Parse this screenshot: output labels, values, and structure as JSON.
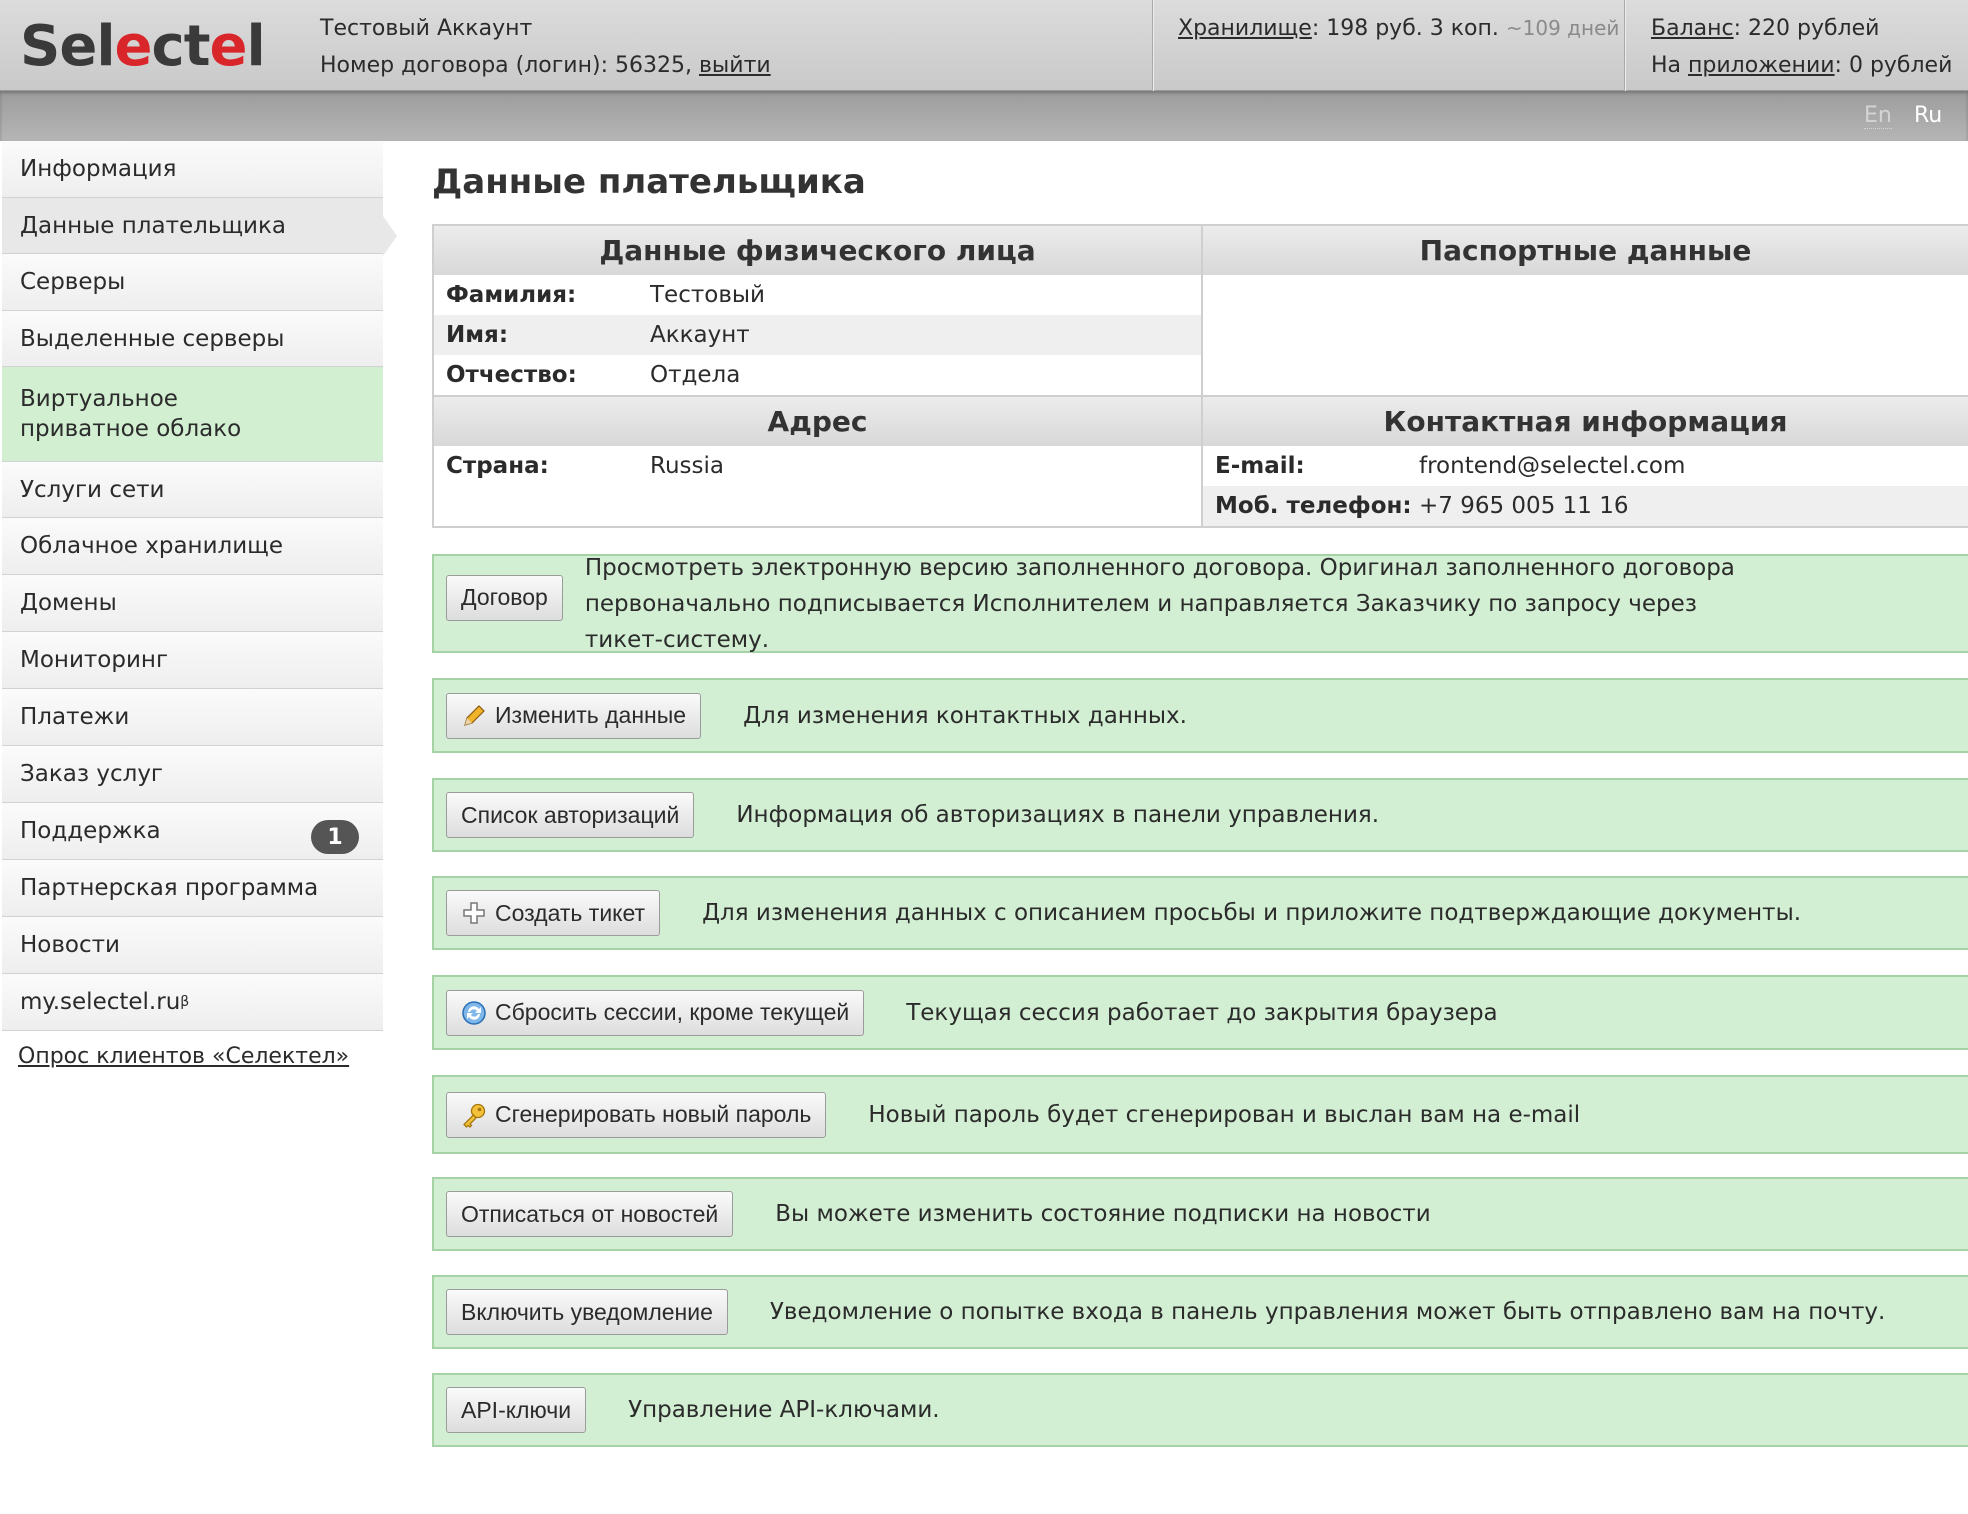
{
  "header": {
    "logo": {
      "part1": "Sel",
      "red": "e",
      "part2": "ct",
      "red2": "e",
      "part3": "l"
    },
    "account_name": "Тестовый Аккаунт",
    "contract_label": "Номер договора (логин): 56325,",
    "logout": "выйти",
    "storage_link": "Хранилище",
    "storage_value": ": 198 руб. 3 коп.",
    "storage_days": "~109 дней",
    "balance_link": "Баланс",
    "balance_value": ": 220 рублей",
    "app_prefix": "На",
    "app_link": "приложении",
    "app_value": ": 0 рублей"
  },
  "lang": {
    "en": "En",
    "ru": "Ru"
  },
  "sidebar": {
    "items": [
      {
        "label": "Информация"
      },
      {
        "label": "Данные плательщика"
      },
      {
        "label": "Серверы"
      },
      {
        "label": "Выделенные серверы"
      },
      {
        "label": "Виртуальное приватное облако"
      },
      {
        "label": "Услуги сети"
      },
      {
        "label": "Облачное хранилище"
      },
      {
        "label": "Домены"
      },
      {
        "label": "Мониторинг"
      },
      {
        "label": "Платежи"
      },
      {
        "label": "Заказ услуг"
      },
      {
        "label": "Поддержка",
        "badge": "1"
      },
      {
        "label": "Партнерская программа"
      },
      {
        "label": "Новости"
      },
      {
        "label": "my.selectel.ru",
        "sup": "β"
      }
    ],
    "survey": "Опрос клиентов «Селектел»"
  },
  "page": {
    "title": "Данные плательщика",
    "personal": {
      "heading": "Данные физического лица",
      "rows": [
        {
          "label": "Фамилия:",
          "value": "Тестовый"
        },
        {
          "label": "Имя:",
          "value": "Аккаунт"
        },
        {
          "label": "Отчество:",
          "value": "Отдела"
        }
      ]
    },
    "passport": {
      "heading": "Паспортные данные"
    },
    "address": {
      "heading": "Адрес",
      "rows": [
        {
          "label": "Страна:",
          "value": "Russia"
        }
      ]
    },
    "contacts": {
      "heading": "Контактная информация",
      "rows": [
        {
          "label": "E-mail:",
          "value": "frontend@selectel.com"
        },
        {
          "label": "Моб. телефон:",
          "value": "+7 965 005 11 16"
        }
      ]
    }
  },
  "actions": [
    {
      "button": "Договор",
      "icon": "",
      "desc": "Просмотреть электронную версию заполненного договора. Оригинал заполненного договора первоначально подписывается Исполнителем и направляется Заказчику по запросу через тикет-систему."
    },
    {
      "button": "Изменить данные",
      "icon": "pencil-icon",
      "desc": "Для изменения контактных данных."
    },
    {
      "button": "Список авторизаций",
      "icon": "",
      "desc": "Информация об авторизациях в панели управления."
    },
    {
      "button": "Создать тикет",
      "icon": "plus-icon",
      "desc": "Для изменения данных с описанием просьбы и приложите подтверждающие документы."
    },
    {
      "button": "Сбросить сессии, кроме текущей",
      "icon": "refresh-icon",
      "desc": "Текущая сессия работает до закрытия браузера"
    },
    {
      "button": "Сгенерировать новый пароль",
      "icon": "key-icon",
      "desc": "Новый пароль будет сгенерирован и выслан вам на e-mail"
    },
    {
      "button": "Отписаться от новостей",
      "icon": "",
      "desc": "Вы можете изменить состояние подписки на новости"
    },
    {
      "button": "Включить уведомление",
      "icon": "",
      "desc": "Уведомление о попытке входа в панель управления может быть отправлено вам на почту."
    },
    {
      "button": "API-ключи",
      "icon": "",
      "desc": "Управление API-ключами."
    }
  ],
  "colors": {
    "brand_red": "#d8262a",
    "green_bg": "#d3efd3",
    "green_border": "#a5d3a5"
  }
}
